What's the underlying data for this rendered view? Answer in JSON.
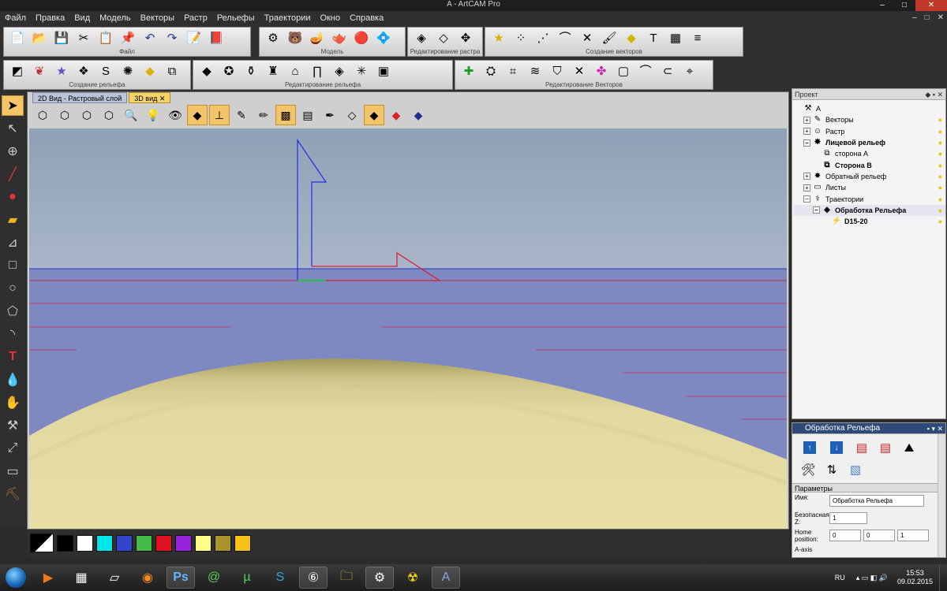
{
  "window": {
    "title": "A - ArtCAM Pro",
    "minimize": "–",
    "maximize": "□",
    "close": "✕"
  },
  "menu": [
    "Файл",
    "Правка",
    "Вид",
    "Модель",
    "Векторы",
    "Растр",
    "Рельефы",
    "Траектории",
    "Окно",
    "Справка"
  ],
  "mdi": {
    "minimize": "–",
    "restore": "□",
    "close": "✕"
  },
  "toolbar_groups": [
    {
      "label": "Файл",
      "icons": [
        "new-file",
        "open-folder",
        "save",
        "cut",
        "copy",
        "paste",
        "undo",
        "redo",
        "edit-notes",
        "book"
      ]
    },
    {
      "label": "Модель",
      "icons": [
        "model-settings",
        "bear-model",
        "lamp",
        "teapot",
        "material-ball",
        "gem"
      ]
    },
    {
      "label": "Редактирование растра",
      "icons": [
        "raster-mirror",
        "raster-rotate",
        "raster-fix"
      ]
    },
    {
      "label": "Создание векторов",
      "icons": [
        "star-vector",
        "node-grid",
        "polyline",
        "arc",
        "cross-cut",
        "brush",
        "diamond",
        "text-vector",
        "grid-text",
        "layer-stack"
      ]
    },
    {
      "label": "Создание рельефа",
      "icons": [
        "relief-shape",
        "leaf",
        "star",
        "spiral",
        "snake",
        "weave",
        "plate",
        "layers"
      ]
    },
    {
      "label": "Редактирование рельефа",
      "icons": [
        "pyramid",
        "dancer",
        "vase",
        "jug",
        "arch",
        "column",
        "gem-edit",
        "burst",
        "cube"
      ]
    },
    {
      "label": "Редактирование Векторов",
      "icons": [
        "plus",
        "bell",
        "corners",
        "wave",
        "shield",
        "cross",
        "pink-cross",
        "box",
        "shapes",
        "smooth",
        "hook",
        "close-shape",
        "target"
      ]
    }
  ],
  "tabs": [
    {
      "label": "2D Вид - Растровый слой"
    },
    {
      "label": "3D вид"
    }
  ],
  "tab_close": "✕",
  "view_icons": [
    "iso-view",
    "front-view",
    "side-view",
    "top-view",
    "zoom",
    "light",
    "eye",
    "plane",
    "axes",
    "brush",
    "pencil",
    "solid",
    "stack",
    "pen",
    "flat",
    "diamond",
    "layers-red",
    "pyramid"
  ],
  "palette": [
    "#000000",
    "#ffffff",
    "#00e5e5",
    "#3344cc",
    "#44bb44",
    "#dd1122",
    "#9922dd",
    "#ffff88",
    "#a8962a",
    "#f5c218"
  ],
  "project_panel": {
    "title": "Проект",
    "tree": [
      {
        "label": "A",
        "indent": 0,
        "icon": "A",
        "exp": ""
      },
      {
        "label": "Векторы",
        "indent": 1,
        "icon": "vec",
        "exp": "+"
      },
      {
        "label": "Растр",
        "indent": 1,
        "icon": "face",
        "exp": "+"
      },
      {
        "label": "Лицевой рельеф",
        "indent": 1,
        "icon": "star",
        "exp": "–",
        "bold": true
      },
      {
        "label": "сторона А",
        "indent": 2,
        "icon": "layer",
        "exp": ""
      },
      {
        "label": "Сторона В",
        "indent": 2,
        "icon": "layer",
        "exp": "",
        "bold": true
      },
      {
        "label": "Обратный рельеф",
        "indent": 1,
        "icon": "star",
        "exp": "+"
      },
      {
        "label": "Листы",
        "indent": 1,
        "icon": "sheet",
        "exp": "+"
      },
      {
        "label": "Траектории",
        "indent": 1,
        "icon": "tool",
        "exp": "–"
      },
      {
        "label": "Обработка Рельефа",
        "indent": 2,
        "icon": "path",
        "exp": "–",
        "bold": true,
        "selected": true
      },
      {
        "label": "D15-20",
        "indent": 3,
        "icon": "drill",
        "exp": "",
        "bold": true
      }
    ]
  },
  "relief_panel": {
    "title": "Обработка Рельефа",
    "section": "Параметры",
    "name_label": "Имя:",
    "name_value": "Обработка Рельефа",
    "safe_z_label": "Безопасная Z:",
    "safe_z_value": "1",
    "home_label": "Home position:",
    "home_values": [
      "0",
      "0",
      "1"
    ],
    "axis_label": "A-axis"
  },
  "taskbar": {
    "apps": [
      "media-player",
      "calculator",
      "notes",
      "firefox",
      "photoshop",
      "at-app",
      "utorrent",
      "skype",
      "artcam-6",
      "folder",
      "tools",
      "radiation",
      "artcam"
    ],
    "lang": "RU",
    "time": "15:53",
    "date": "09.02.2015"
  }
}
